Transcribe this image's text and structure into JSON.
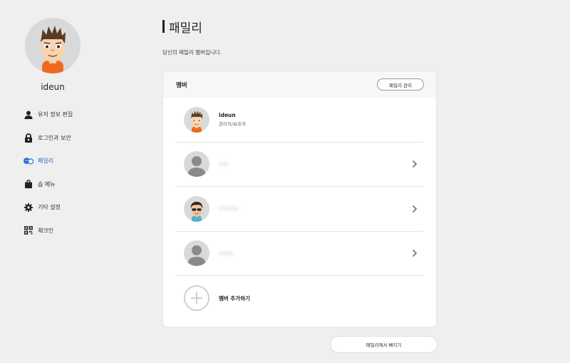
{
  "profile": {
    "name": "ideun"
  },
  "sidebar": {
    "items": [
      {
        "label": "유저 정보 편집",
        "icon": "user-icon"
      },
      {
        "label": "로그인과 보안",
        "icon": "lock-icon"
      },
      {
        "label": "패밀리",
        "icon": "family-icon",
        "active": true
      },
      {
        "label": "숍 메뉴",
        "icon": "shopping-bag-icon"
      },
      {
        "label": "기타 설정",
        "icon": "gear-icon"
      },
      {
        "label": "체크인",
        "icon": "qr-code-icon"
      }
    ]
  },
  "main": {
    "title": "패밀리",
    "subtitle": "당신의 패밀리 멤버입니다."
  },
  "card": {
    "title": "멤버",
    "manage_label": "패밀리 관리",
    "members": [
      {
        "name": "ideun",
        "role": "관리자/보호자"
      },
      {
        "name": "ㅇㅇ"
      },
      {
        "name": "ㅇㅇㅇㅇ"
      },
      {
        "name": "ㅇㅇㅇ"
      }
    ],
    "add_label": "멤버 추가하기"
  },
  "footer": {
    "leave_label": "패밀리에서 빠지기"
  },
  "colors": {
    "accent": "#2a6ed8",
    "background": "#efefef",
    "avatar_bg": "#d9d9d9"
  }
}
